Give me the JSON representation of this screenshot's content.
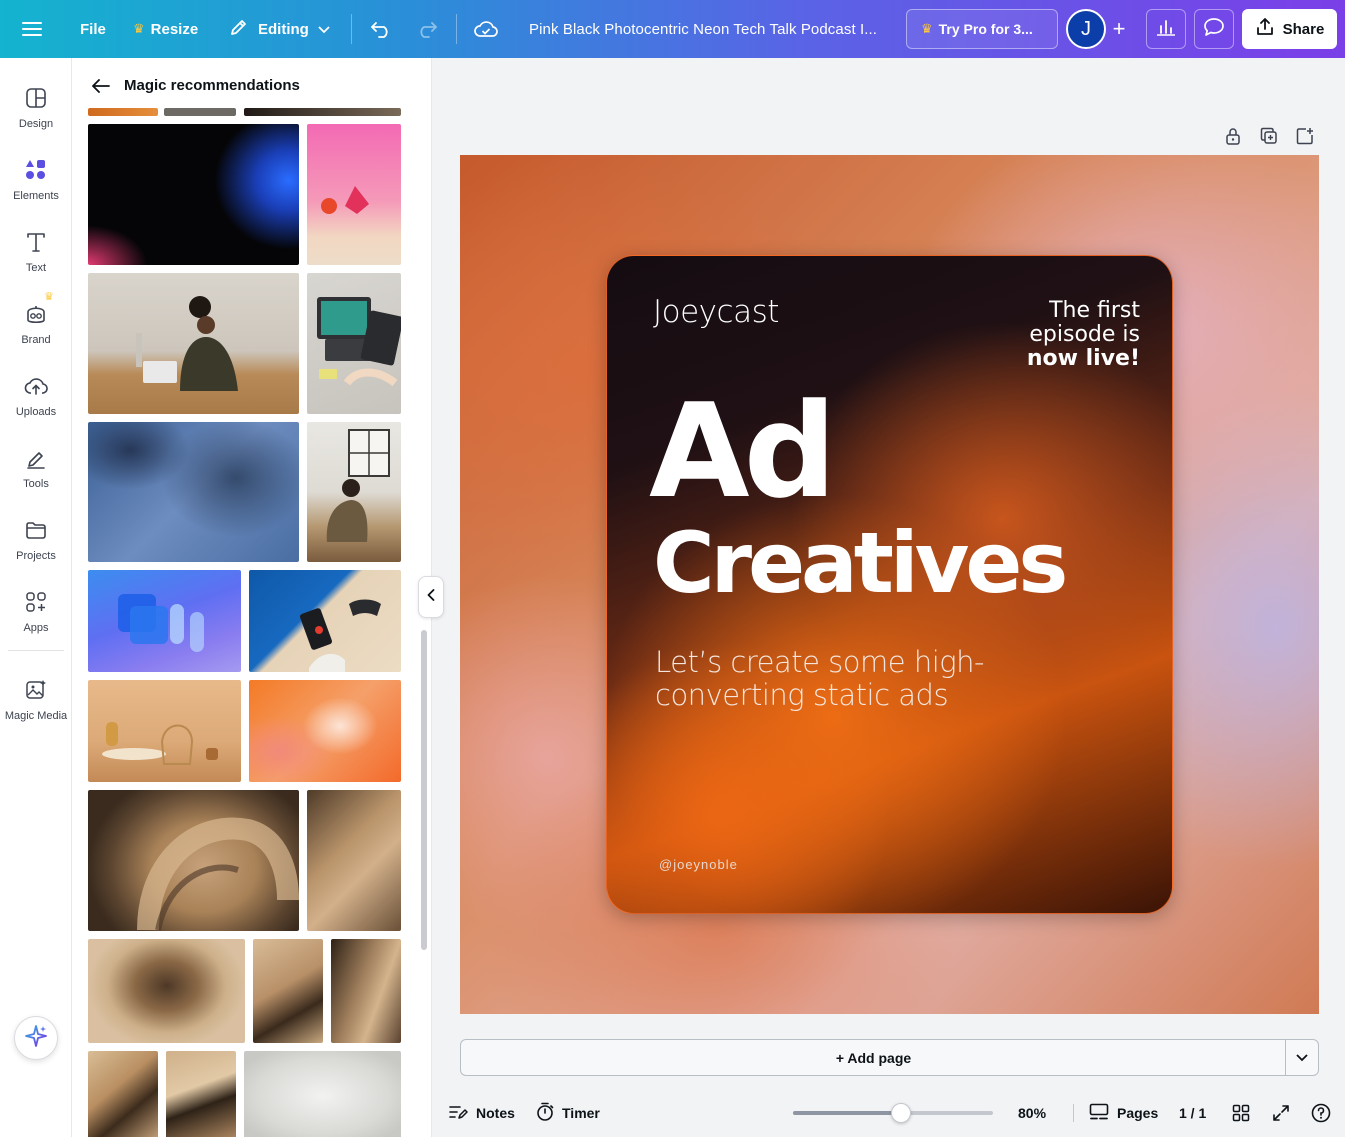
{
  "topbar": {
    "file_label": "File",
    "resize_label": "Resize",
    "editing_label": "Editing",
    "doc_title": "Pink Black Photocentric Neon Tech Talk Podcast I...",
    "try_pro_label": "Try Pro for 3...",
    "avatar_initial": "J",
    "share_label": "Share"
  },
  "rail": {
    "items": [
      {
        "label": "Design",
        "icon": "design-icon"
      },
      {
        "label": "Elements",
        "icon": "elements-icon"
      },
      {
        "label": "Text",
        "icon": "text-icon"
      },
      {
        "label": "Brand",
        "icon": "brand-icon"
      },
      {
        "label": "Uploads",
        "icon": "uploads-icon"
      },
      {
        "label": "Tools",
        "icon": "tools-icon"
      },
      {
        "label": "Projects",
        "icon": "projects-icon"
      },
      {
        "label": "Apps",
        "icon": "apps-icon"
      },
      {
        "label": "Magic Media",
        "icon": "magic-media-icon"
      }
    ]
  },
  "panel": {
    "title": "Magic recommendations"
  },
  "design": {
    "brand": "Joeycast",
    "episode_line1": "The first",
    "episode_line2": "episode is",
    "episode_line3": "now live!",
    "headline1": "Ad",
    "headline2": "Creatives",
    "subtitle": "Let’s create some high-converting static ads",
    "handle": "@joeynoble"
  },
  "canvas": {
    "add_page_label": "+ Add page"
  },
  "bottombar": {
    "notes_label": "Notes",
    "timer_label": "Timer",
    "zoom_label": "80%",
    "zoom_level_fraction": 0.54,
    "pages_label": "Pages",
    "page_count": "1 / 1"
  },
  "colors": {
    "topbar_gradient_start": "#14b3cf",
    "topbar_gradient_end": "#7b3fe8",
    "accent_purple": "#7d2ae8",
    "design_orange": "#e8641a"
  }
}
